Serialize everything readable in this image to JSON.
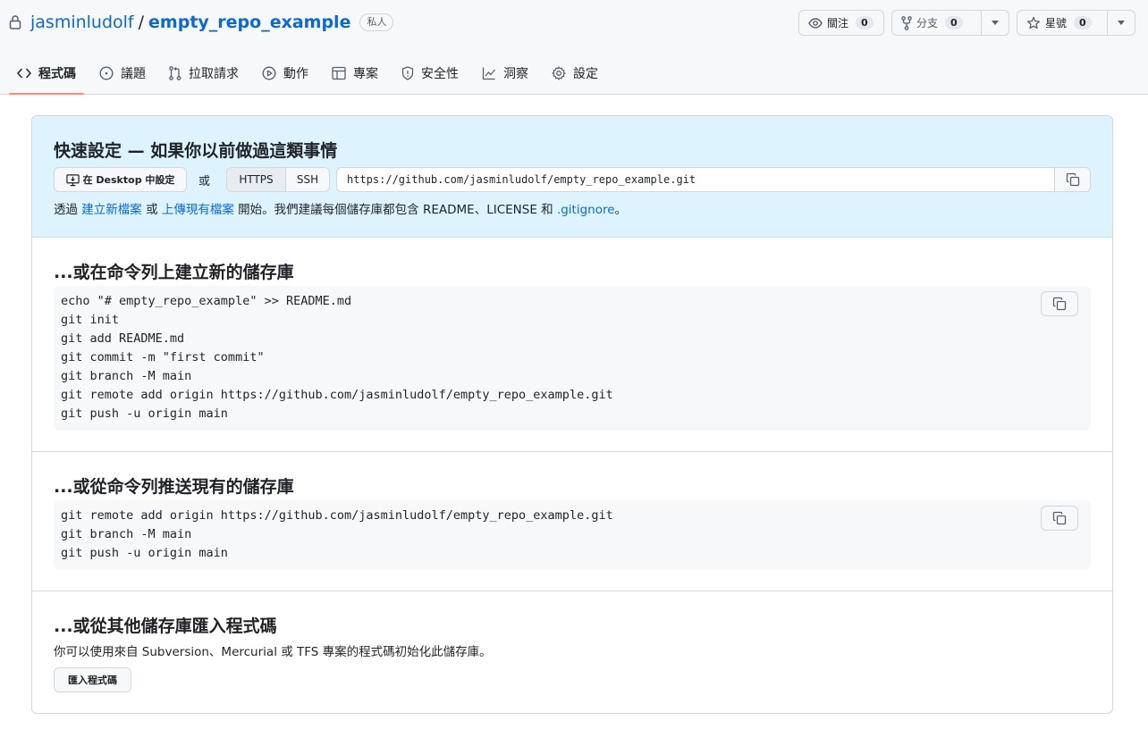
{
  "repo": {
    "owner": "jasminludolf",
    "separator": "/",
    "name": "empty_repo_example",
    "visibility": "私人"
  },
  "actions": {
    "watch": {
      "label": "關注",
      "count": "0"
    },
    "fork": {
      "label": "分支",
      "count": "0"
    },
    "star": {
      "label": "星號",
      "count": "0"
    }
  },
  "tabs": [
    {
      "label": "程式碼",
      "icon": "code-icon",
      "active": true
    },
    {
      "label": "議題",
      "icon": "issue-opened-icon"
    },
    {
      "label": "拉取請求",
      "icon": "git-pull-request-icon"
    },
    {
      "label": "動作",
      "icon": "play-icon"
    },
    {
      "label": "專案",
      "icon": "table-icon"
    },
    {
      "label": "安全性",
      "icon": "shield-icon"
    },
    {
      "label": "洞察",
      "icon": "graph-icon"
    },
    {
      "label": "設定",
      "icon": "gear-icon"
    }
  ],
  "quick_setup": {
    "title": "快速設定 — 如果你以前做過這類事情",
    "desktop_button": "在 Desktop 中設定",
    "or": "或",
    "protocols": [
      "HTTPS",
      "SSH"
    ],
    "selected_protocol": "HTTPS",
    "clone_url": "https://github.com/jasminludolf/empty_repo_example.git",
    "hint_prefix": "透過 ",
    "hint_link1": "建立新檔案",
    "hint_or": " 或 ",
    "hint_link2": "上傳現有檔案",
    "hint_suffix": " 開始。我們建議每個儲存庫都包含 README、LICENSE 和 ",
    "hint_link3": ".gitignore",
    "hint_end": "。"
  },
  "new_repo": {
    "title": "...或在命令列上建立新的儲存庫",
    "lines": [
      "echo \"# empty_repo_example\" >> README.md",
      "git init",
      "git add README.md",
      "git commit -m \"first commit\"",
      "git branch -M main",
      "git remote add origin https://github.com/jasminludolf/empty_repo_example.git",
      "git push -u origin main"
    ]
  },
  "push_existing": {
    "title": "...或從命令列推送現有的儲存庫",
    "lines": [
      "git remote add origin https://github.com/jasminludolf/empty_repo_example.git",
      "git branch -M main",
      "git push -u origin main"
    ]
  },
  "import_code": {
    "title": "...或從其他儲存庫匯入程式碼",
    "description": "你可以使用來自 Subversion、Mercurial 或 TFS 專案的程式碼初始化此儲存庫。",
    "button": "匯入程式碼"
  },
  "colors": {
    "link": "#0969da",
    "quick_setup_bg": "#ddf4ff",
    "active_tab_underline": "#fd8c73"
  }
}
